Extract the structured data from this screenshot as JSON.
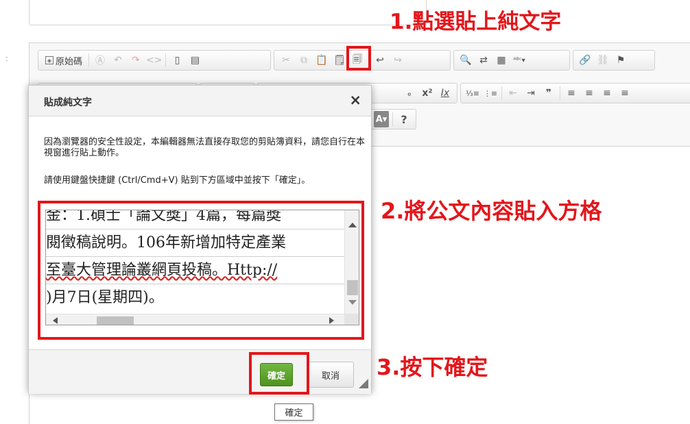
{
  "annotations": {
    "step1": "1.點選貼上純文字",
    "step2": "2.將公文內容貼入方格",
    "step3": "3.按下確定"
  },
  "toolbar": {
    "source_label": "原始碼",
    "row2_icons": {
      "subscript": "ₑ",
      "superscript": "x²",
      "remove_format": "Ix",
      "numbered_list": "⅓≡",
      "bullet_list": "⋮≡",
      "outdent": "⇤",
      "indent": "⇥",
      "blockquote": "❞",
      "align_left": "≡",
      "align_center": "≡",
      "align_right": "≡",
      "justify": "≡"
    },
    "row3_icons": {
      "text_color": "A▾",
      "bg_color": "A▾",
      "help": "?"
    }
  },
  "dialog": {
    "title": "貼成純文字",
    "close": "×",
    "description": "因為瀏覽器的安全性設定，本編輯器無法直接存取您的剪貼簿資料，請您自行在本視窗進行貼上動作。",
    "instruction": "請使用鍵盤快捷鍵 (Ctrl/Cmd+V) 貼到下方區域中並按下「確定」。",
    "paste_lines": [
      "金：1.碩士「論文獎」4篇，每篇獎",
      "閱徵稿說明。106年新增加特定產業",
      "至臺大管理論叢網頁投稿。Http://",
      ")月7日(星期四)。"
    ],
    "ok_label": "確定",
    "cancel_label": "取消"
  },
  "tooltip": "確定",
  "colors": {
    "annotation_red": "#e3161b",
    "ok_green": "#5aa02c"
  }
}
